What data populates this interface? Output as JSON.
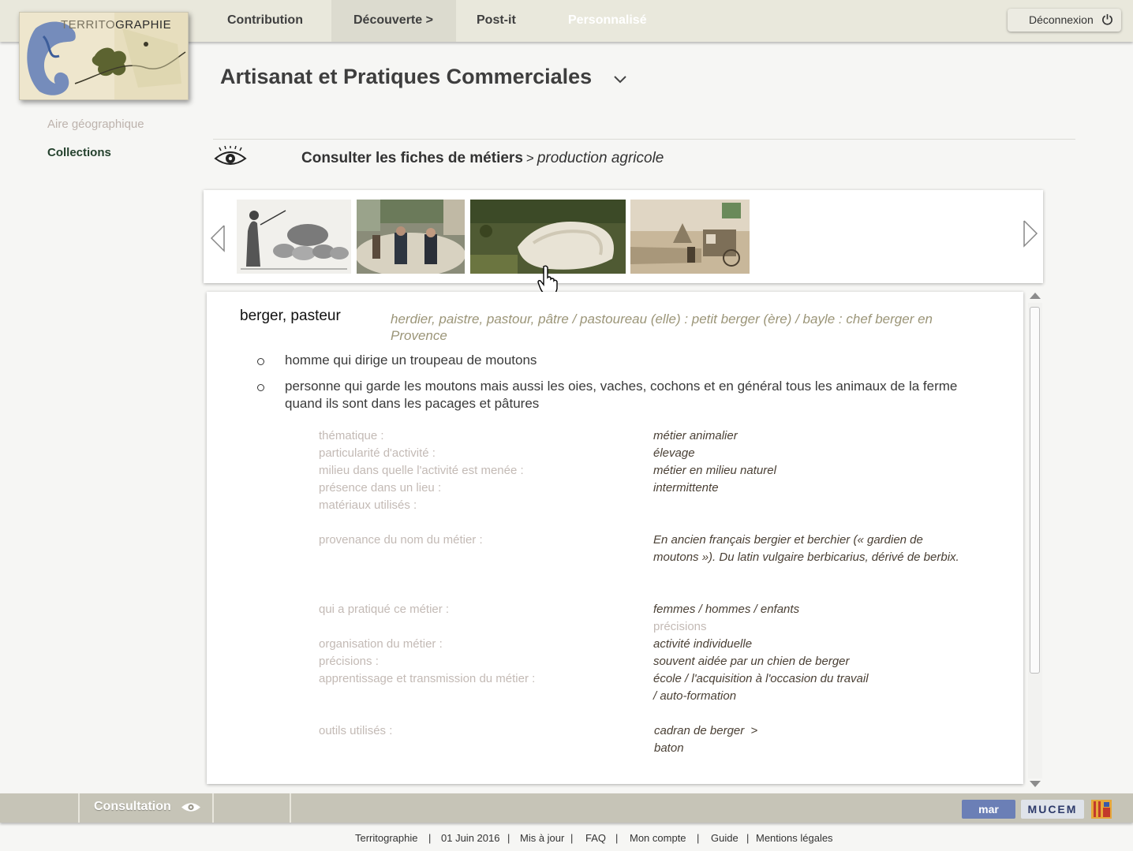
{
  "nav": {
    "contribution": "Contribution",
    "decouverte": "Découverte >",
    "postit": "Post-it",
    "personnalise": "Personnalisé",
    "logout": "Déconnexion"
  },
  "logo": {
    "part1": "TERRITO",
    "part2": "GRAPHIE"
  },
  "sidebar": {
    "geo": "Aire géographique",
    "collections": "Collections"
  },
  "page_title": "Artisanat et Pratiques Commerciales",
  "breadcrumb": {
    "main": "Consulter les fiches de métiers",
    "sep": ">",
    "sub": "production agricole"
  },
  "carousel": {
    "thumbnails": [
      "shepherd-engraving",
      "shepherds-crowd-sheep",
      "sheep-flock-mountain",
      "postcard-shepherd-wagon"
    ]
  },
  "detail": {
    "term": "berger, pasteur",
    "synonyms": "herdier, paistre, pastour, pâtre / pastoureau (elle) : petit berger (ère) / bayle : chef berger en Provence",
    "definitions": [
      "homme qui dirige un troupeau de moutons",
      "personne qui garde les moutons mais aussi les oies, vaches, cochons et en général tous les animaux de la ferme quand ils sont dans les pacages et pâtures"
    ],
    "props": {
      "thematique_label": "thématique :",
      "thematique_value": "métier animalier",
      "particularite_label": "particularité d'activité :",
      "particularite_value": "élevage",
      "milieu_label": "milieu dans quelle l'activité est menée :",
      "milieu_value": "métier en milieu naturel",
      "presence_label": "présence dans un lieu :",
      "presence_value": "intermittente",
      "materiaux_label": "matériaux utilisés :",
      "provenance_label": "provenance du nom du métier :",
      "provenance_value": "En ancien français bergier et berchier (« gardien de moutons »). Du latin vulgaire berbicarius, dérivé de berbix.",
      "pratique_label": "qui a pratiqué ce métier  :",
      "pratique_value": "femmes / hommes / enfants",
      "pratique_precisions": "précisions",
      "organisation_label": "organisation du métier :",
      "organisation_value": "activité individuelle",
      "precisions_label": "précisions :",
      "precisions_value": "souvent aidée par un chien de berger",
      "apprentissage_label": "apprentissage et transmission du métier :",
      "apprentissage_value_1": "école / l'acquisition à l'occasion du travail",
      "apprentissage_value_2": "/ auto-formation",
      "outils_label": "outils utilisés :",
      "outils_value_1": "cadran de berger",
      "outils_arrow": ">",
      "outils_value_2": "baton"
    }
  },
  "bottombar": {
    "consultation": "Consultation",
    "partners": [
      "mmsh",
      "MUCEM",
      "region"
    ],
    "partner_texts": {
      "mmsh": "mar",
      "mucem": "MUCEM"
    }
  },
  "footer": {
    "items": [
      "Territographie",
      "|",
      "01 Juin 2016",
      "|",
      "Mis à jour",
      "|",
      "FAQ",
      "|",
      "Mon compte",
      "|",
      "Guide",
      "|",
      "Mentions légales"
    ]
  }
}
